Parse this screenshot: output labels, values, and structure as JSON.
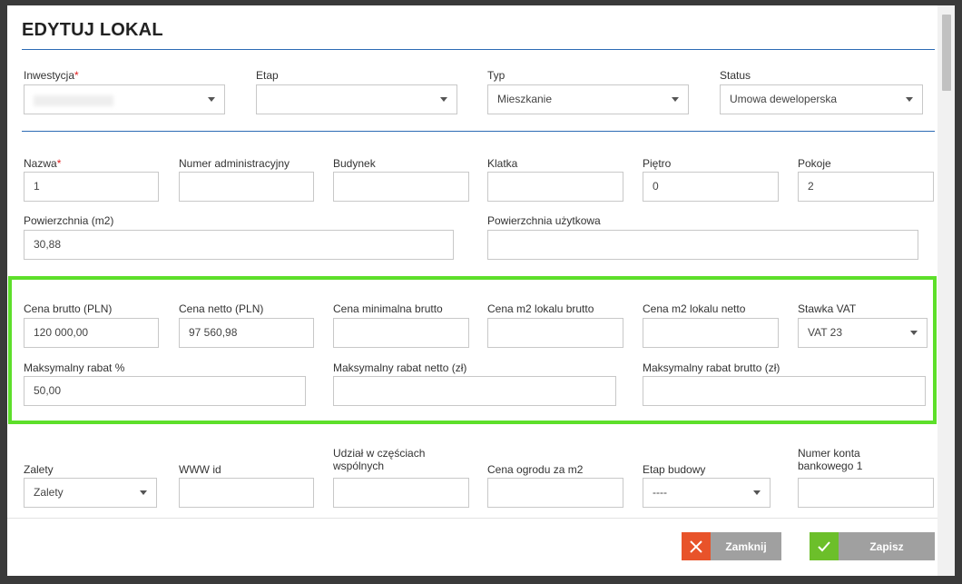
{
  "modal": {
    "title": "EDYTUJ LOKAL"
  },
  "section1": {
    "inwestycja": {
      "label": "Inwestycja",
      "value": ""
    },
    "etap": {
      "label": "Etap",
      "value": ""
    },
    "typ": {
      "label": "Typ",
      "value": "Mieszkanie"
    },
    "status": {
      "label": "Status",
      "value": "Umowa deweloperska"
    }
  },
  "section2": {
    "nazwa": {
      "label": "Nazwa",
      "value": "1"
    },
    "numer_adm": {
      "label": "Numer administracyjny",
      "value": ""
    },
    "budynek": {
      "label": "Budynek",
      "value": ""
    },
    "klatka": {
      "label": "Klatka",
      "value": ""
    },
    "pietro": {
      "label": "Piętro",
      "value": "0"
    },
    "pokoje": {
      "label": "Pokoje",
      "value": "2"
    },
    "powierzchnia": {
      "label": "Powierzchnia (m2)",
      "value": "30,88"
    },
    "pow_uzytkowa": {
      "label": "Powierzchnia użytkowa",
      "value": ""
    }
  },
  "section3": {
    "cena_brutto": {
      "label": "Cena brutto (PLN)",
      "value": "120 000,00"
    },
    "cena_netto": {
      "label": "Cena netto (PLN)",
      "value": "97 560,98"
    },
    "cena_min": {
      "label": "Cena minimalna brutto",
      "value": ""
    },
    "cena_m2_brutto": {
      "label": "Cena m2 lokalu brutto",
      "value": ""
    },
    "cena_m2_netto": {
      "label": "Cena m2 lokalu netto",
      "value": ""
    },
    "stawka_vat": {
      "label": "Stawka VAT",
      "value": "VAT 23"
    },
    "max_rabat": {
      "label": "Maksymalny rabat %",
      "value": "50,00"
    },
    "max_rabat_netto": {
      "label": "Maksymalny rabat netto (zł)",
      "value": ""
    },
    "max_rabat_brutto": {
      "label": "Maksymalny rabat brutto (zł)",
      "value": ""
    }
  },
  "section4": {
    "zalety": {
      "label": "Zalety",
      "value": "Zalety"
    },
    "www_id": {
      "label": "WWW id",
      "value": ""
    },
    "udzial": {
      "label": "Udział w częściach wspólnych",
      "value": ""
    },
    "cena_ogrodu": {
      "label": "Cena ogrodu za m2",
      "value": ""
    },
    "etap_budowy": {
      "label": "Etap budowy",
      "value": "----"
    },
    "numer_konta": {
      "label": "Numer konta bankowego 1",
      "value": ""
    }
  },
  "footer": {
    "close_label": "Zamknij",
    "save_label": "Zapisz"
  },
  "colors": {
    "accent_line": "#2d6bb5",
    "highlight": "#5ddf2a",
    "close_button": "#a0a0a0",
    "close_icon_bg": "#e8532a",
    "save_button": "#a0a0a0",
    "save_icon_bg": "#6cbf2a",
    "required": "#e02020"
  }
}
